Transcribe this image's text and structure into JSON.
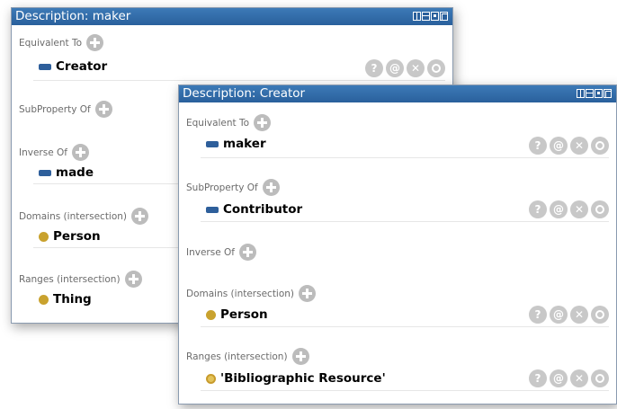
{
  "panels": {
    "maker": {
      "title": "Description: maker",
      "sections": {
        "equivalent_to": {
          "label": "Equivalent To",
          "entry": "Creator"
        },
        "subproperty_of": {
          "label": "SubProperty Of"
        },
        "inverse_of": {
          "label": "Inverse Of",
          "entry": "made"
        },
        "domains": {
          "label": "Domains (intersection)",
          "entry": "Person"
        },
        "ranges": {
          "label": "Ranges (intersection)",
          "entry": "Thing"
        }
      }
    },
    "creator": {
      "title": "Description: Creator",
      "sections": {
        "equivalent_to": {
          "label": "Equivalent To",
          "entry": "maker"
        },
        "subproperty_of": {
          "label": "SubProperty Of",
          "entry": "Contributor"
        },
        "inverse_of": {
          "label": "Inverse Of"
        },
        "domains": {
          "label": "Domains (intersection)",
          "entry": "Person"
        },
        "ranges": {
          "label": "Ranges (intersection)",
          "entry": "'Bibliographic Resource'"
        }
      }
    }
  },
  "action_buttons": {
    "help": "?",
    "annotate": "@",
    "delete": "✕"
  },
  "icons": {
    "property": "object-property-icon",
    "class": "class-icon",
    "add": "add-icon"
  },
  "colors": {
    "title_bar": "#2a609c",
    "property_icon": "#2e5f9b",
    "class_icon": "#c9a22e",
    "button_gray": "#bcbcbc"
  }
}
